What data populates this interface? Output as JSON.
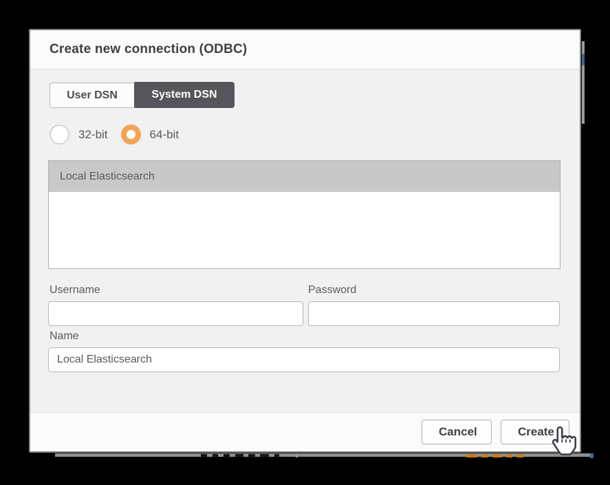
{
  "dialog": {
    "title": "Create new connection (ODBC)",
    "tabs": [
      {
        "label": "User DSN",
        "selected": false
      },
      {
        "label": "System DSN",
        "selected": true
      }
    ],
    "radio": {
      "options": [
        {
          "label": "32-bit",
          "selected": false
        },
        {
          "label": "64-bit",
          "selected": true
        }
      ]
    },
    "dsn_list": {
      "items": [
        {
          "label": "Local Elasticsearch",
          "selected": true
        }
      ]
    },
    "fields": {
      "username": {
        "label": "Username",
        "value": ""
      },
      "password": {
        "label": "Password",
        "value": ""
      },
      "name": {
        "label": "Name",
        "value": "Local Elasticsearch"
      }
    },
    "footer": {
      "cancel_label": "Cancel",
      "create_label": "Create"
    }
  },
  "icons": {
    "cursor": "hand-pointer-icon"
  },
  "colors": {
    "overlay": "#000000",
    "accent_orange": "#f2a45a",
    "tab_selected_bg": "#54565b",
    "selected_row_bg": "#c8c8c8",
    "header_bg": "#fbfbfb",
    "body_bg": "#f1f1f2",
    "text_dark": "#404040",
    "text_gray": "#595959",
    "input_border": "#b4b4b4"
  }
}
